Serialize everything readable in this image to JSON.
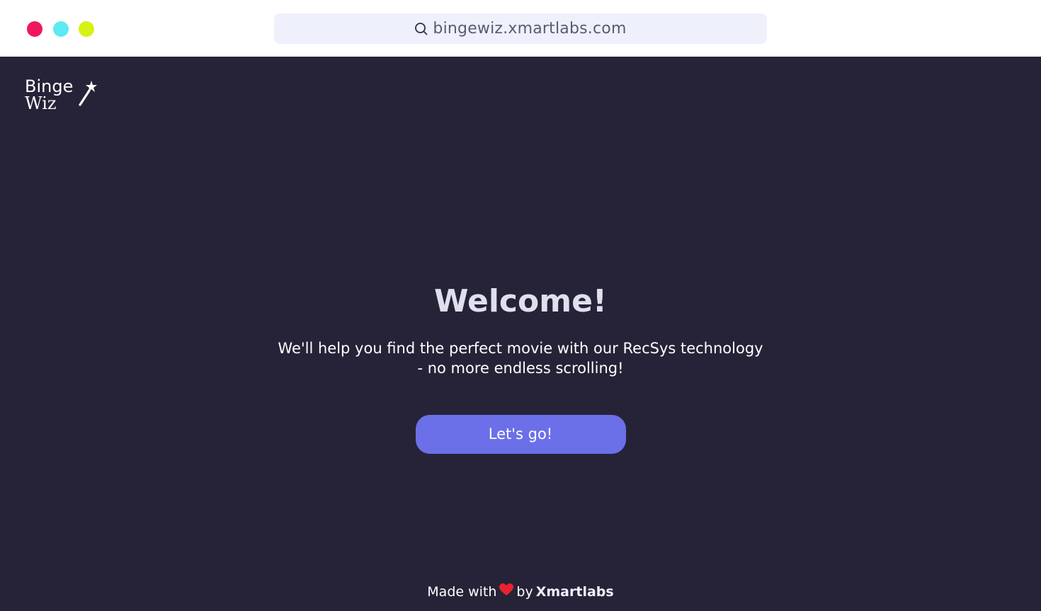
{
  "browser": {
    "address": "bingewiz.xmartlabs.com",
    "traffic_colors": [
      "#f0185c",
      "#5ee9f3",
      "#d6f213"
    ],
    "icons": {
      "search": "search-icon"
    }
  },
  "logo": {
    "line1": "Binge",
    "line2": "Wiz",
    "icon": "magic-wand-icon"
  },
  "hero": {
    "title": "Welcome!",
    "subtitle_line1": "We'll help you find the perfect movie with our RecSys technology",
    "subtitle_line2": "- no more endless scrolling!",
    "cta_label": "Let's go!"
  },
  "footer": {
    "made_with": "Made with",
    "heart_icon": "heart-icon",
    "by": "by",
    "brand": "Xmartlabs"
  },
  "colors": {
    "background": "#262338",
    "accent": "#6b70e8",
    "heart": "#e8232e"
  }
}
